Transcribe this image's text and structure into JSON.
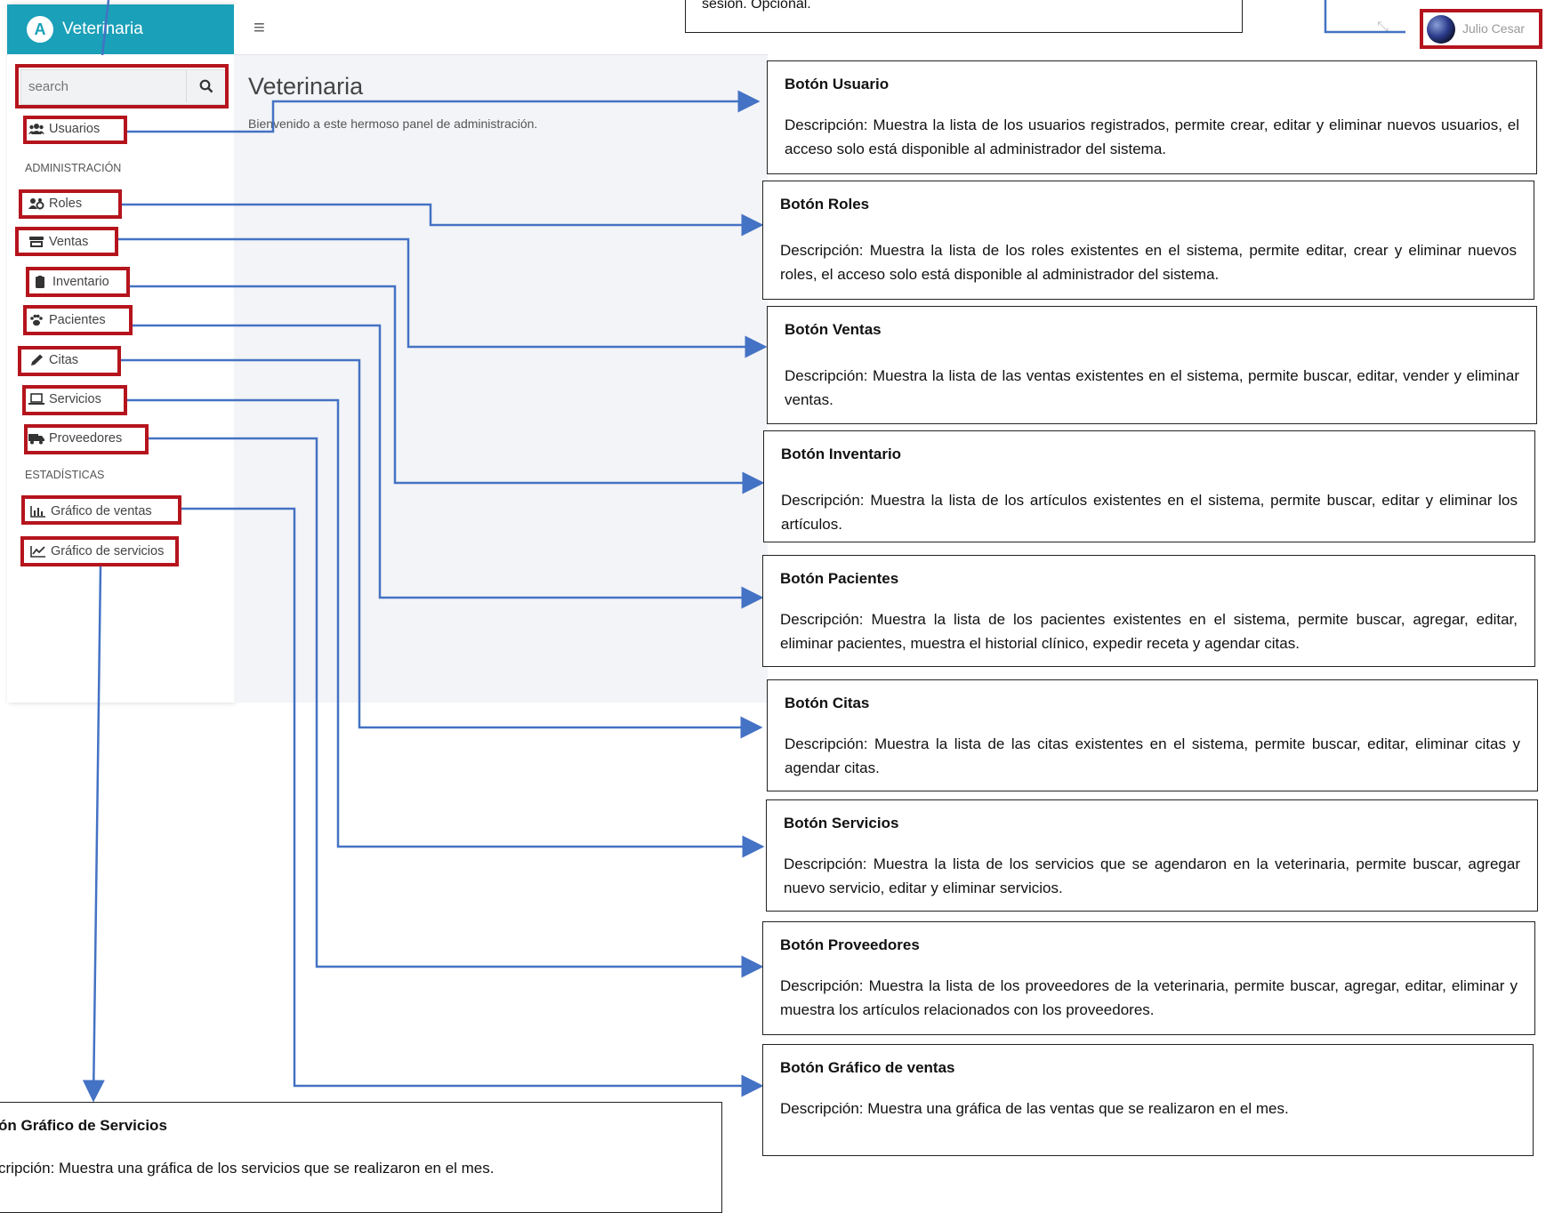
{
  "app": {
    "brand": "Veterinaria",
    "brand_logo": "A",
    "search_placeholder": "search",
    "page_title": "Veterinaria",
    "welcome": "Bienvenido a este hermoso panel de administración.",
    "user_name": "Julio Cesar",
    "nav": {
      "usuarios": "Usuarios",
      "header_admin": "ADMINISTRACIÓN",
      "roles": "Roles",
      "ventas": "Ventas",
      "inventario": "Inventario",
      "pacientes": "Pacientes",
      "citas": "Citas",
      "servicios": "Servicios",
      "proveedores": "Proveedores",
      "header_stats": "ESTADÍSTICAS",
      "grafico_ventas": "Gráfico de ventas",
      "grafico_servicios": "Gráfico de servicios"
    }
  },
  "top_note": "sesión. Opcional.",
  "descriptions": {
    "usuario": {
      "title": "Botón Usuario",
      "text": "Descripción: Muestra la lista de los usuarios registrados, permite crear, editar y eliminar nuevos usuarios, el acceso solo está disponible al administrador del sistema."
    },
    "roles": {
      "title": "Botón Roles",
      "text": "Descripción: Muestra la lista de los roles existentes en el sistema, permite editar, crear y eliminar nuevos roles, el acceso solo está disponible al administrador del sistema."
    },
    "ventas": {
      "title": "Botón Ventas",
      "text": "Descripción: Muestra la lista de las ventas existentes en el sistema, permite buscar, editar, vender y eliminar ventas."
    },
    "inventario": {
      "title": "Botón Inventario",
      "text": "Descripción: Muestra la lista de los artículos existentes en el sistema, permite buscar, editar y eliminar los artículos."
    },
    "pacientes": {
      "title": "Botón Pacientes",
      "text": "Descripción: Muestra la lista de los pacientes existentes en el sistema, permite buscar, agregar, editar, eliminar pacientes, muestra el historial clínico, expedir receta y agendar citas."
    },
    "citas": {
      "title": "Botón Citas",
      "text": "Descripción: Muestra la lista de las citas existentes en el sistema, permite buscar, editar, eliminar citas y agendar citas."
    },
    "servicios": {
      "title": "Botón Servicios",
      "text": "Descripción: Muestra la lista de los servicios que se agendaron en la veterinaria, permite buscar, agregar nuevo servicio, editar y eliminar servicios."
    },
    "proveedores": {
      "title": "Botón Proveedores",
      "text": "Descripción: Muestra la lista de los proveedores de la veterinaria, permite buscar, agregar, editar, eliminar y muestra los artículos relacionados con los proveedores."
    },
    "grafico_ventas": {
      "title": "Botón Gráfico de ventas",
      "text": "Descripción: Muestra una gráfica de las ventas que se realizaron en el mes."
    },
    "grafico_servicios": {
      "title": "ón Gráfico de Servicios",
      "text": "cripción: Muestra una gráfica de los servicios que se realizaron en el mes."
    }
  },
  "colors": {
    "brand": "#1aa0b8",
    "highlight": "#b5141d",
    "arrow": "#4472c4"
  }
}
